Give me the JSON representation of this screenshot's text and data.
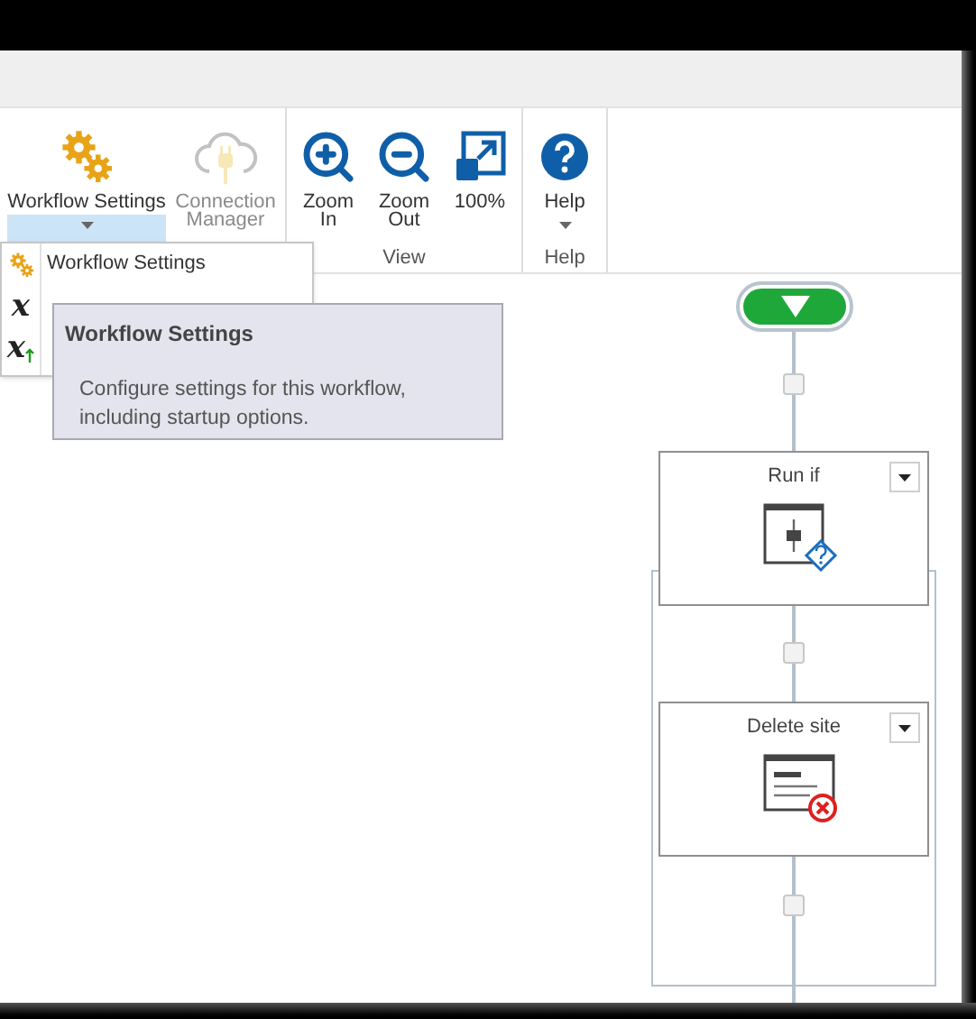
{
  "ribbon": {
    "groups": [
      {
        "buttons": [
          {
            "kind": "gears",
            "label": "Workflow Settings",
            "dropdown": true,
            "selected": true,
            "disabled": false
          },
          {
            "kind": "cloud",
            "label": "Connection Manager",
            "dropdown": false,
            "selected": false,
            "disabled": true
          }
        ]
      },
      {
        "label": "View",
        "buttons": [
          {
            "kind": "zoom-in",
            "label": "Zoom In",
            "dropdown": false,
            "selected": false,
            "disabled": false
          },
          {
            "kind": "zoom-out",
            "label": "Zoom Out",
            "dropdown": false,
            "selected": false,
            "disabled": false
          },
          {
            "kind": "fit",
            "label": "100%",
            "dropdown": false,
            "selected": false,
            "disabled": false
          }
        ]
      },
      {
        "label": "Help",
        "buttons": [
          {
            "kind": "help",
            "label": "Help",
            "dropdown": true,
            "selected": false,
            "disabled": false
          }
        ]
      }
    ]
  },
  "menu": {
    "items": [
      {
        "kind": "gear",
        "label": "Workflow Settings"
      },
      {
        "kind": "variable",
        "glyph": "x"
      },
      {
        "kind": "variable-up",
        "glyph": "x"
      }
    ]
  },
  "tooltip": {
    "title": "Workflow Settings",
    "text": "Configure settings for this workflow, including startup options."
  },
  "workflow": {
    "steps": [
      {
        "kind": "condition",
        "title": "Run if"
      },
      {
        "kind": "delete",
        "title": "Delete site"
      }
    ]
  }
}
